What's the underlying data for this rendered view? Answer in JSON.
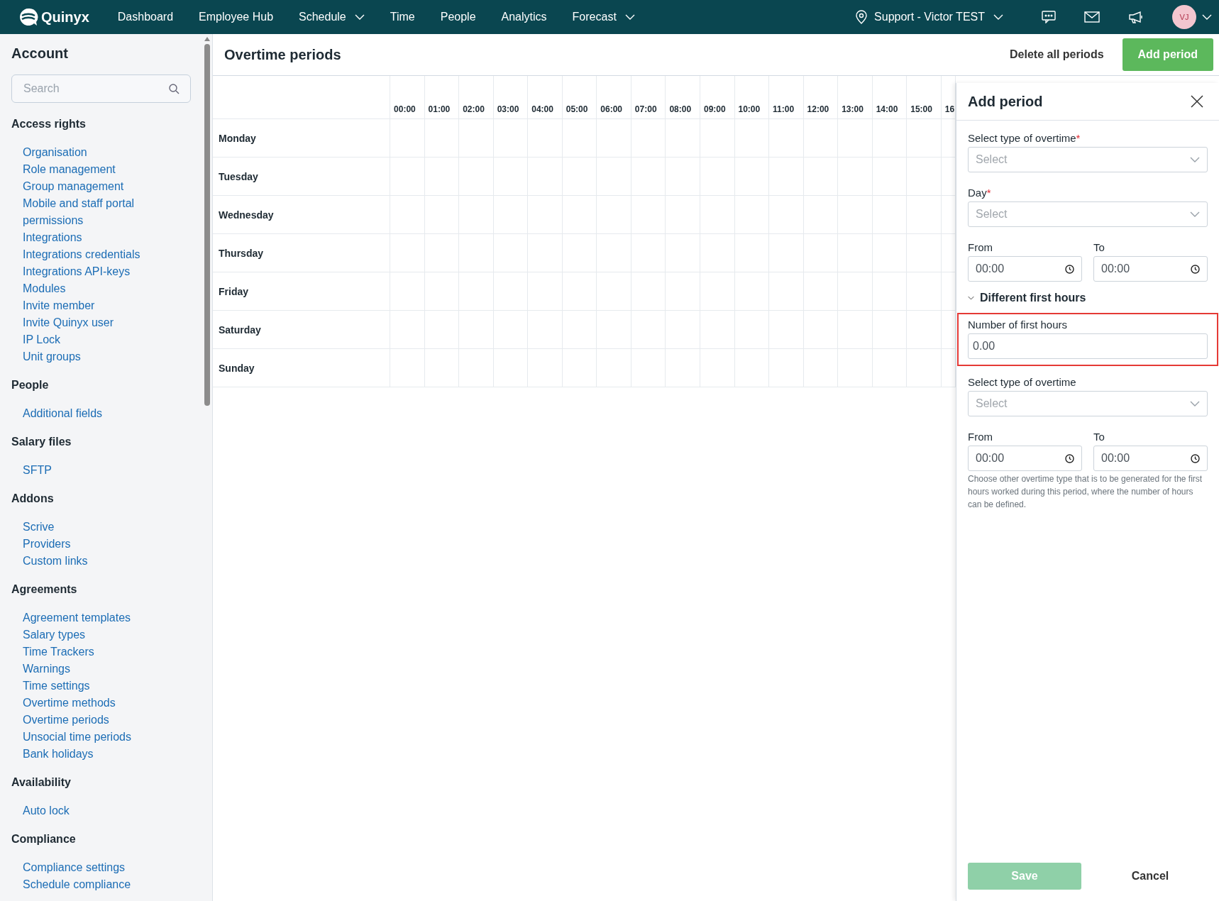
{
  "nav": {
    "logo": "Quinyx",
    "items": [
      {
        "label": "Dashboard",
        "dropdown": false
      },
      {
        "label": "Employee Hub",
        "dropdown": false
      },
      {
        "label": "Schedule",
        "dropdown": true
      },
      {
        "label": "Time",
        "dropdown": false
      },
      {
        "label": "People",
        "dropdown": false
      },
      {
        "label": "Analytics",
        "dropdown": false
      },
      {
        "label": "Forecast",
        "dropdown": true
      }
    ],
    "location": "Support - Victor TEST",
    "avatar": "VJ"
  },
  "sidebar": {
    "title": "Account",
    "search": {
      "placeholder": "Search"
    },
    "sections": [
      {
        "heading": "Access rights",
        "items": [
          "Organisation",
          "Role management",
          "Group management",
          "Mobile and staff portal permissions",
          "Integrations",
          "Integrations credentials",
          "Integrations API-keys",
          "Modules",
          "Invite member",
          "Invite Quinyx user",
          "IP Lock",
          "Unit groups"
        ]
      },
      {
        "heading": "People",
        "items": [
          "Additional fields"
        ]
      },
      {
        "heading": "Salary files",
        "items": [
          "SFTP"
        ]
      },
      {
        "heading": "Addons",
        "items": [
          "Scrive",
          "Providers",
          "Custom links"
        ]
      },
      {
        "heading": "Agreements",
        "items": [
          "Agreement templates",
          "Salary types",
          "Time Trackers",
          "Warnings",
          "Time settings",
          "Overtime methods",
          "Overtime periods",
          "Unsocial time periods",
          "Bank holidays"
        ]
      },
      {
        "heading": "Availability",
        "items": [
          "Auto lock"
        ]
      },
      {
        "heading": "Compliance",
        "items": [
          "Compliance settings",
          "Schedule compliance"
        ]
      }
    ]
  },
  "page": {
    "title": "Overtime periods",
    "actions": [
      {
        "label": "Delete all periods",
        "kind": "text"
      },
      {
        "label": "Add period",
        "kind": "primary"
      }
    ]
  },
  "grid": {
    "hours": [
      "00:00",
      "01:00",
      "02:00",
      "03:00",
      "04:00",
      "05:00",
      "06:00",
      "07:00",
      "08:00",
      "09:00",
      "10:00",
      "11:00",
      "12:00",
      "13:00",
      "14:00",
      "15:00",
      "16"
    ],
    "days": [
      "Monday",
      "Tuesday",
      "Wednesday",
      "Thursday",
      "Friday",
      "Saturday",
      "Sunday"
    ]
  },
  "panel": {
    "title": "Add period",
    "required_mark": "*",
    "fields": [
      {
        "kind": "select",
        "label": "Select type of overtime",
        "required": true,
        "placeholder": "Select"
      },
      {
        "kind": "select",
        "label": "Day",
        "required": true,
        "placeholder": "Select"
      },
      {
        "kind": "times",
        "from": {
          "label": "From",
          "value": "00:00"
        },
        "to": {
          "label": "To",
          "value": "00:00"
        }
      },
      {
        "kind": "toggle",
        "label": "Different first hours",
        "expanded": true
      },
      {
        "kind": "number",
        "label": "Number of first hours",
        "value": "0.00",
        "highlighted": true
      },
      {
        "kind": "select",
        "label": "Select type of overtime",
        "required": false,
        "placeholder": "Select"
      },
      {
        "kind": "times",
        "from": {
          "label": "From",
          "value": "00:00"
        },
        "to": {
          "label": "To",
          "value": "00:00"
        }
      },
      {
        "kind": "help",
        "text": "Choose other overtime type that is to be generated for the first hours worked during this period, where the number of hours can be defined."
      }
    ],
    "save": {
      "label": "Save",
      "disabled": true
    },
    "cancel": "Cancel"
  }
}
